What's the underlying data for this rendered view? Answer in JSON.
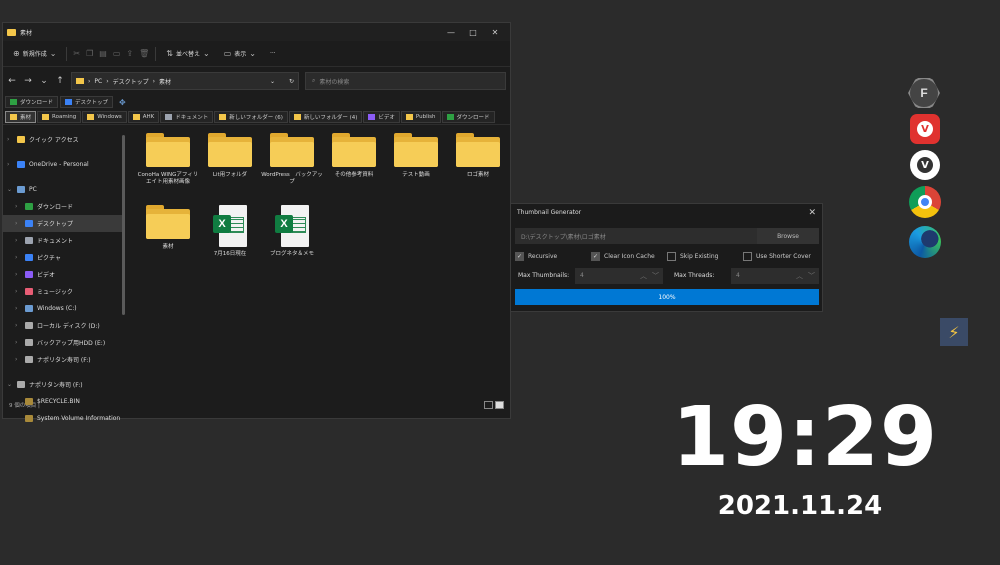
{
  "explorer": {
    "title": "素材",
    "toolbar": {
      "new_label": "新規作成",
      "sort_label": "並べ替え",
      "view_label": "表示",
      "more_label": "···"
    },
    "address": {
      "path": [
        "PC",
        "デスクトップ",
        "素材"
      ],
      "search_placeholder": "素材の検索"
    },
    "bookmarks_row1": [
      {
        "label": "ダウンロード",
        "color": "#2ea043"
      },
      {
        "label": "デスクトップ",
        "color": "#3b82f6"
      }
    ],
    "bookmarks_row2": [
      {
        "label": "素材",
        "color": "#f3c64a"
      },
      {
        "label": "Roaming",
        "color": "#f3c64a"
      },
      {
        "label": "Windows",
        "color": "#f3c64a"
      },
      {
        "label": "AHK",
        "color": "#f3c64a"
      },
      {
        "label": "ドキュメント",
        "color": "#9ca3af"
      },
      {
        "label": "新しいフォルダー (6)",
        "color": "#f3c64a"
      },
      {
        "label": "新しいフォルダー (4)",
        "color": "#f3c64a"
      },
      {
        "label": "ビデオ",
        "color": "#8b5cf6"
      },
      {
        "label": "Publish",
        "color": "#f3c64a"
      },
      {
        "label": "ダウンロード",
        "color": "#2ea043"
      }
    ],
    "sidebar": [
      {
        "label": "クイック アクセス",
        "color": "#f3c64a",
        "indent": 0,
        "chev": "›"
      },
      {
        "label": "",
        "color": "",
        "indent": 0,
        "chev": ""
      },
      {
        "label": "OneDrive - Personal",
        "color": "#3b82f6",
        "indent": 0,
        "chev": "›"
      },
      {
        "label": "",
        "color": "",
        "indent": 0,
        "chev": ""
      },
      {
        "label": "PC",
        "color": "#6b9bd1",
        "indent": 0,
        "chev": "⌄"
      },
      {
        "label": "ダウンロード",
        "color": "#2ea043",
        "indent": 1,
        "chev": "›"
      },
      {
        "label": "デスクトップ",
        "color": "#3b82f6",
        "indent": 1,
        "chev": "›",
        "selected": true
      },
      {
        "label": "ドキュメント",
        "color": "#9ca3af",
        "indent": 1,
        "chev": "›"
      },
      {
        "label": "ピクチャ",
        "color": "#3b82f6",
        "indent": 1,
        "chev": "›"
      },
      {
        "label": "ビデオ",
        "color": "#8b5cf6",
        "indent": 1,
        "chev": "›"
      },
      {
        "label": "ミュージック",
        "color": "#e85d75",
        "indent": 1,
        "chev": "›"
      },
      {
        "label": "Windows (C:)",
        "color": "#6b9bd1",
        "indent": 1,
        "chev": "›"
      },
      {
        "label": "ローカル ディスク (D:)",
        "color": "#aaaaaa",
        "indent": 1,
        "chev": "›"
      },
      {
        "label": "バックアップ用HDD (E:)",
        "color": "#aaaaaa",
        "indent": 1,
        "chev": "›"
      },
      {
        "label": "ナポリタン寿司 (F:)",
        "color": "#aaaaaa",
        "indent": 1,
        "chev": "›"
      },
      {
        "label": "",
        "color": "",
        "indent": 0,
        "chev": ""
      },
      {
        "label": "ナポリタン寿司 (F:)",
        "color": "#aaaaaa",
        "indent": 0,
        "chev": "⌄"
      },
      {
        "label": "$RECYCLE.BIN",
        "color": "#a8893a",
        "indent": 1,
        "chev": ""
      },
      {
        "label": "System Volume Information",
        "color": "#a8893a",
        "indent": 1,
        "chev": ""
      }
    ],
    "items": [
      {
        "name": "ConoHa WINGアフィリエイト用素材画像",
        "type": "folder"
      },
      {
        "name": "Lit用フォルダ",
        "type": "folder"
      },
      {
        "name": "WordPress　バックアップ",
        "type": "folder"
      },
      {
        "name": "その他参考資料",
        "type": "folder"
      },
      {
        "name": "テスト動画",
        "type": "folder"
      },
      {
        "name": "ロゴ素材",
        "type": "folder"
      },
      {
        "name": "素材",
        "type": "folder"
      },
      {
        "name": "7月16日現在",
        "type": "excel"
      },
      {
        "name": "ブログネタ＆メモ",
        "type": "excel"
      }
    ],
    "status": "9 個の項目 |"
  },
  "thumbgen": {
    "title": "Thumbnail Generator",
    "path_value": "D:\\デスクトップ\\素材\\ロゴ素材",
    "browse_label": "Browse",
    "options": [
      {
        "label": "Recursive",
        "checked": true
      },
      {
        "label": "Clear Icon Cache",
        "checked": true
      },
      {
        "label": "Skip Existing",
        "checked": false
      },
      {
        "label": "Use Shorter Cover",
        "checked": false
      }
    ],
    "max_thumbnails_label": "Max Thumbnails:",
    "max_thumbnails_value": "4",
    "max_threads_label": "Max Threads:",
    "max_threads_value": "4",
    "progress": 1.0,
    "progress_text": "100%"
  },
  "desktop": {
    "time": "19:29",
    "date": "2021.11.24",
    "icons": [
      "hex-app-icon",
      "vivaldi-icon",
      "vivaldi-icon",
      "chrome-icon",
      "edge-icon",
      "lightning-tile-icon"
    ]
  }
}
